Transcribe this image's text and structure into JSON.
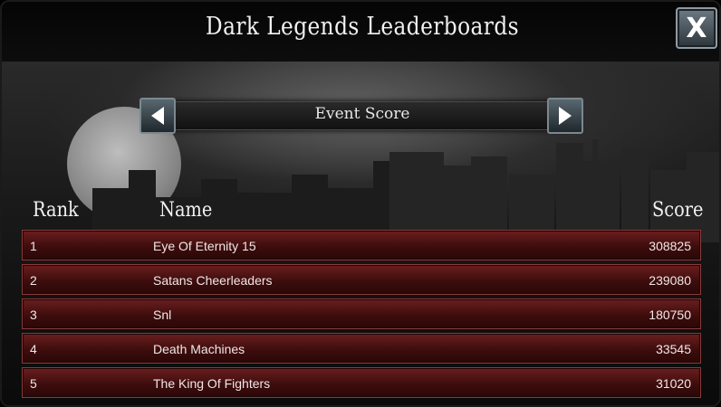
{
  "header": {
    "title": "Dark Legends Leaderboards",
    "close_label": "X"
  },
  "selector": {
    "label": "Event Score"
  },
  "columns": {
    "rank": "Rank",
    "name": "Name",
    "score": "Score"
  },
  "rows": [
    {
      "rank": "1",
      "name": "Eye Of Eternity 15",
      "score": "308825"
    },
    {
      "rank": "2",
      "name": "Satans Cheerleaders",
      "score": "239080"
    },
    {
      "rank": "3",
      "name": "Snl",
      "score": "180750"
    },
    {
      "rank": "4",
      "name": "Death Machines",
      "score": "33545"
    },
    {
      "rank": "5",
      "name": "The King Of Fighters",
      "score": "31020"
    }
  ]
}
